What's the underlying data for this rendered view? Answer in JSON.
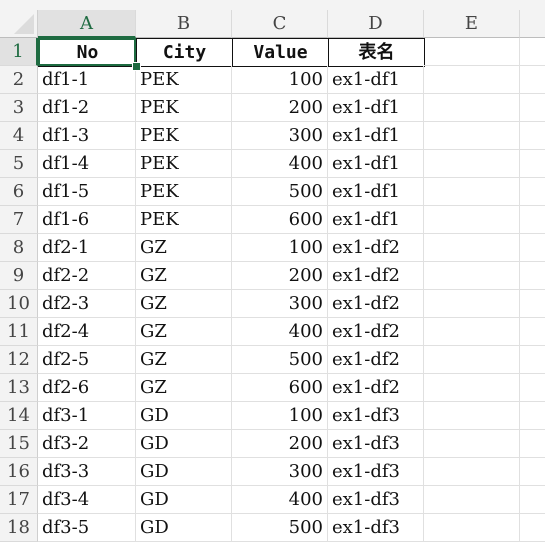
{
  "columns": [
    "A",
    "B",
    "C",
    "D",
    "E"
  ],
  "selected_cell": "A1",
  "accent_color": "#1e6b41",
  "header_row": [
    "No",
    "City",
    "Value",
    "表名"
  ],
  "rows": [
    [
      "df1-1",
      "PEK",
      "100",
      "ex1-df1"
    ],
    [
      "df1-2",
      "PEK",
      "200",
      "ex1-df1"
    ],
    [
      "df1-3",
      "PEK",
      "300",
      "ex1-df1"
    ],
    [
      "df1-4",
      "PEK",
      "400",
      "ex1-df1"
    ],
    [
      "df1-5",
      "PEK",
      "500",
      "ex1-df1"
    ],
    [
      "df1-6",
      "PEK",
      "600",
      "ex1-df1"
    ],
    [
      "df2-1",
      "GZ",
      "100",
      "ex1-df2"
    ],
    [
      "df2-2",
      "GZ",
      "200",
      "ex1-df2"
    ],
    [
      "df2-3",
      "GZ",
      "300",
      "ex1-df2"
    ],
    [
      "df2-4",
      "GZ",
      "400",
      "ex1-df2"
    ],
    [
      "df2-5",
      "GZ",
      "500",
      "ex1-df2"
    ],
    [
      "df2-6",
      "GZ",
      "600",
      "ex1-df2"
    ],
    [
      "df3-1",
      "GD",
      "100",
      "ex1-df3"
    ],
    [
      "df3-2",
      "GD",
      "200",
      "ex1-df3"
    ],
    [
      "df3-3",
      "GD",
      "300",
      "ex1-df3"
    ],
    [
      "df3-4",
      "GD",
      "400",
      "ex1-df3"
    ],
    [
      "df3-5",
      "GD",
      "500",
      "ex1-df3"
    ]
  ]
}
